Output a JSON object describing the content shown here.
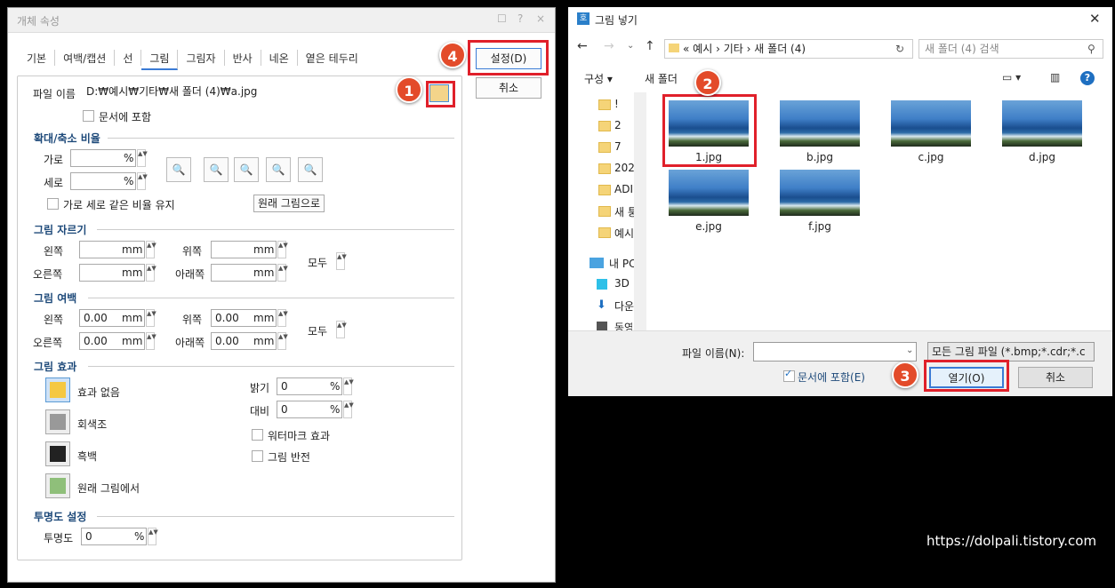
{
  "left": {
    "title": "개체 속성",
    "title_icons": [
      "☐",
      "?",
      "×"
    ],
    "tabs": [
      "기본",
      "여백/캡션",
      "선",
      "그림",
      "그림자",
      "반사",
      "네온",
      "옅은 테두리"
    ],
    "active_tab": "그림",
    "set_button": "설정(D)",
    "cancel_button": "취소",
    "file_label": "파일 이름",
    "file_value": "D:₩예시₩기타₩새 폴더 (4)₩a.jpg",
    "embed_label": "문서에 포함",
    "scale_section": "확대/축소 비율",
    "width_label": "가로",
    "height_label": "세로",
    "percent": "%",
    "zoom_labels": [
      "100%",
      "1/2",
      "2/3",
      "3/2",
      "×2"
    ],
    "keep_ratio_label": "가로 세로 같은 비율 유지",
    "original_button": "원래 그림으로",
    "crop_section": "그림 자르기",
    "left_label": "왼쪽",
    "right_label": "오른쪽",
    "top_label": "위쪽",
    "bottom_label": "아래쪽",
    "all_label": "모두",
    "mm": "mm",
    "margin_section": "그림 여백",
    "margin_value": "0.00",
    "effect_section": "그림 효과",
    "effects": [
      "효과 없음",
      "회색조",
      "흑백",
      "원래 그림에서"
    ],
    "brightness_label": "밝기",
    "contrast_label": "대비",
    "brightness_value": "0",
    "contrast_value": "0",
    "watermark_label": "워터마크 효과",
    "invert_label": "그림 반전",
    "transparency_section": "투명도 설정",
    "transparency_label": "투명도",
    "transparency_value": "0"
  },
  "right": {
    "title": "그림 넣기",
    "app_icon": "호",
    "path_parts": [
      "«",
      "예시",
      "›",
      "기타",
      "›",
      "새 폴더 (4)"
    ],
    "search_placeholder": "새 폴더 (4) 검색",
    "organize": "구성 ▾",
    "new_folder": "새 폴더",
    "sidebar": [
      "!",
      "2",
      "7",
      "202",
      "ADI",
      "새 퉁",
      "예시",
      "내 PC",
      "3D",
      "다운",
      "동영"
    ],
    "files": [
      "1.jpg",
      "b.jpg",
      "c.jpg",
      "d.jpg",
      "e.jpg",
      "f.jpg"
    ],
    "filename_label": "파일 이름(N):",
    "filter": "모든 그림 파일 (*.bmp;*.cdr;*.c",
    "embed_label": "문서에 포함(E)",
    "open_button": "열기(O)",
    "cancel_button": "취소"
  },
  "badges": [
    "1",
    "2",
    "3",
    "4"
  ],
  "site": "https://dolpali.tistory.com"
}
